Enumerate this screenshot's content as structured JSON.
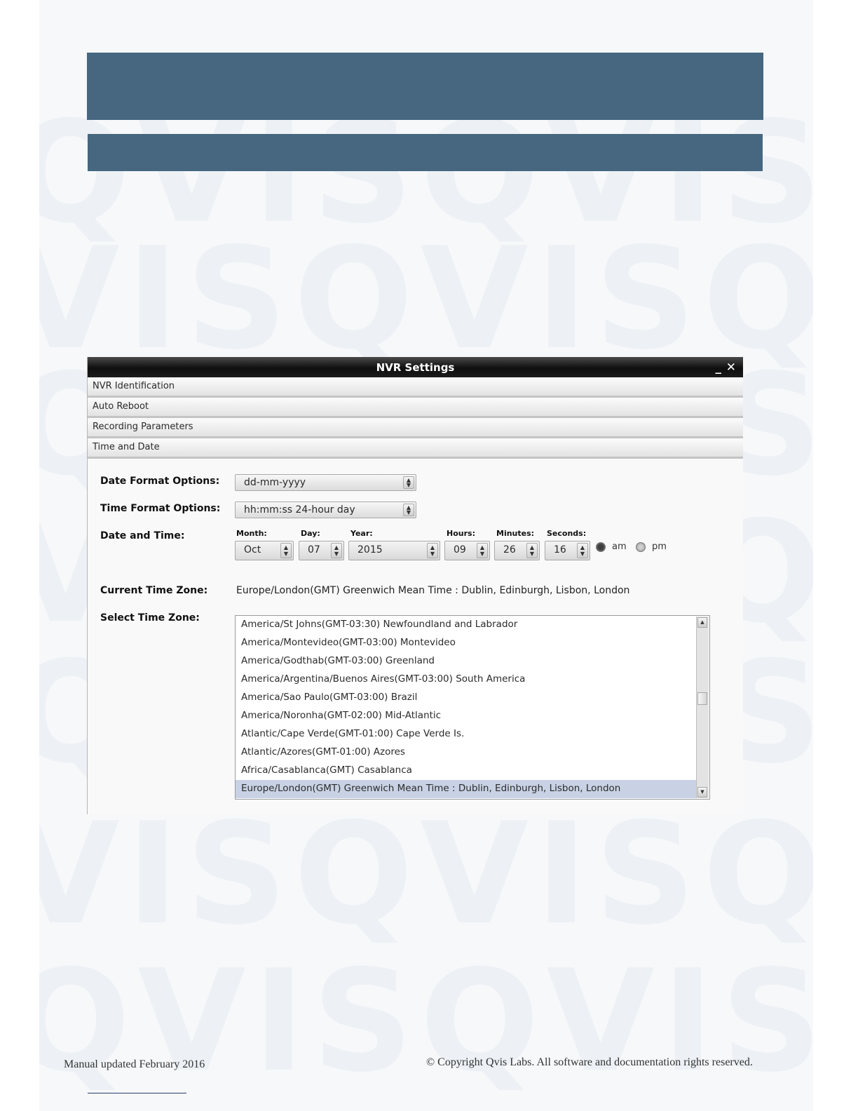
{
  "window": {
    "title": "NVR Settings",
    "minimize_glyph": "_",
    "close_glyph": "✕"
  },
  "accordion": [
    {
      "label": "NVR Identification"
    },
    {
      "label": "Auto Reboot"
    },
    {
      "label": "Recording Parameters"
    },
    {
      "label": "Time and Date"
    }
  ],
  "time_date": {
    "date_format_label": "Date Format Options:",
    "date_format_value": "dd-mm-yyyy",
    "time_format_label": "Time Format Options:",
    "time_format_value": "hh:mm:ss 24-hour day",
    "date_time_label": "Date and Time:",
    "month_label": "Month:",
    "month_value": "Oct",
    "day_label": "Day:",
    "day_value": "07",
    "year_label": "Year:",
    "year_value": "2015",
    "hours_label": "Hours:",
    "hours_value": "09",
    "minutes_label": "Minutes:",
    "minutes_value": "26",
    "seconds_label": "Seconds:",
    "seconds_value": "16",
    "am_label": "am",
    "pm_label": "pm",
    "am_selected": true,
    "current_tz_label": "Current Time Zone:",
    "current_tz_value": "Europe/London(GMT) Greenwich Mean Time : Dublin, Edinburgh, Lisbon, London",
    "select_tz_label": "Select Time Zone:",
    "tz_options": [
      "America/St Johns(GMT-03:30) Newfoundland and Labrador",
      "America/Montevideo(GMT-03:00) Montevideo",
      "America/Godthab(GMT-03:00) Greenland",
      "America/Argentina/Buenos Aires(GMT-03:00) South America",
      "America/Sao Paulo(GMT-03:00) Brazil",
      "America/Noronha(GMT-02:00) Mid-Atlantic",
      "Atlantic/Cape Verde(GMT-01:00) Cape Verde Is.",
      "Atlantic/Azores(GMT-01:00) Azores",
      "Africa/Casablanca(GMT) Casablanca",
      "Europe/London(GMT) Greenwich Mean Time : Dublin, Edinburgh, Lisbon, London"
    ],
    "tz_selected_index": 9
  },
  "footer": {
    "left": "Manual updated February 2016",
    "right": "© Copyright Qvis Labs. All software and documentation rights reserved."
  },
  "colors": {
    "banner": "#46677f",
    "selection": "#c8d2e4"
  },
  "icons": {
    "spin": "spinner-arrows-icon",
    "scroll_up": "scroll-up-icon",
    "scroll_down": "scroll-down-icon"
  }
}
